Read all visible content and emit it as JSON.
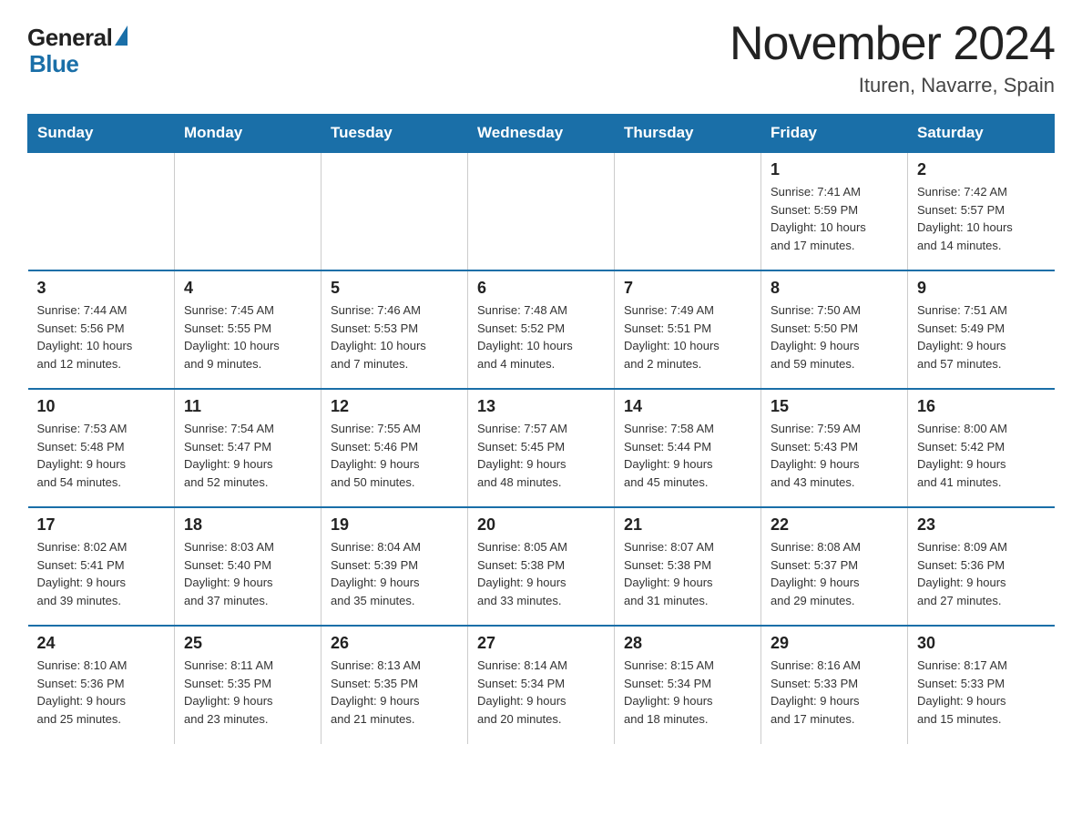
{
  "header": {
    "logo": {
      "general": "General",
      "blue": "Blue"
    },
    "title": "November 2024",
    "subtitle": "Ituren, Navarre, Spain"
  },
  "weekdays": [
    "Sunday",
    "Monday",
    "Tuesday",
    "Wednesday",
    "Thursday",
    "Friday",
    "Saturday"
  ],
  "weeks": [
    [
      {
        "day": "",
        "info": ""
      },
      {
        "day": "",
        "info": ""
      },
      {
        "day": "",
        "info": ""
      },
      {
        "day": "",
        "info": ""
      },
      {
        "day": "",
        "info": ""
      },
      {
        "day": "1",
        "info": "Sunrise: 7:41 AM\nSunset: 5:59 PM\nDaylight: 10 hours\nand 17 minutes."
      },
      {
        "day": "2",
        "info": "Sunrise: 7:42 AM\nSunset: 5:57 PM\nDaylight: 10 hours\nand 14 minutes."
      }
    ],
    [
      {
        "day": "3",
        "info": "Sunrise: 7:44 AM\nSunset: 5:56 PM\nDaylight: 10 hours\nand 12 minutes."
      },
      {
        "day": "4",
        "info": "Sunrise: 7:45 AM\nSunset: 5:55 PM\nDaylight: 10 hours\nand 9 minutes."
      },
      {
        "day": "5",
        "info": "Sunrise: 7:46 AM\nSunset: 5:53 PM\nDaylight: 10 hours\nand 7 minutes."
      },
      {
        "day": "6",
        "info": "Sunrise: 7:48 AM\nSunset: 5:52 PM\nDaylight: 10 hours\nand 4 minutes."
      },
      {
        "day": "7",
        "info": "Sunrise: 7:49 AM\nSunset: 5:51 PM\nDaylight: 10 hours\nand 2 minutes."
      },
      {
        "day": "8",
        "info": "Sunrise: 7:50 AM\nSunset: 5:50 PM\nDaylight: 9 hours\nand 59 minutes."
      },
      {
        "day": "9",
        "info": "Sunrise: 7:51 AM\nSunset: 5:49 PM\nDaylight: 9 hours\nand 57 minutes."
      }
    ],
    [
      {
        "day": "10",
        "info": "Sunrise: 7:53 AM\nSunset: 5:48 PM\nDaylight: 9 hours\nand 54 minutes."
      },
      {
        "day": "11",
        "info": "Sunrise: 7:54 AM\nSunset: 5:47 PM\nDaylight: 9 hours\nand 52 minutes."
      },
      {
        "day": "12",
        "info": "Sunrise: 7:55 AM\nSunset: 5:46 PM\nDaylight: 9 hours\nand 50 minutes."
      },
      {
        "day": "13",
        "info": "Sunrise: 7:57 AM\nSunset: 5:45 PM\nDaylight: 9 hours\nand 48 minutes."
      },
      {
        "day": "14",
        "info": "Sunrise: 7:58 AM\nSunset: 5:44 PM\nDaylight: 9 hours\nand 45 minutes."
      },
      {
        "day": "15",
        "info": "Sunrise: 7:59 AM\nSunset: 5:43 PM\nDaylight: 9 hours\nand 43 minutes."
      },
      {
        "day": "16",
        "info": "Sunrise: 8:00 AM\nSunset: 5:42 PM\nDaylight: 9 hours\nand 41 minutes."
      }
    ],
    [
      {
        "day": "17",
        "info": "Sunrise: 8:02 AM\nSunset: 5:41 PM\nDaylight: 9 hours\nand 39 minutes."
      },
      {
        "day": "18",
        "info": "Sunrise: 8:03 AM\nSunset: 5:40 PM\nDaylight: 9 hours\nand 37 minutes."
      },
      {
        "day": "19",
        "info": "Sunrise: 8:04 AM\nSunset: 5:39 PM\nDaylight: 9 hours\nand 35 minutes."
      },
      {
        "day": "20",
        "info": "Sunrise: 8:05 AM\nSunset: 5:38 PM\nDaylight: 9 hours\nand 33 minutes."
      },
      {
        "day": "21",
        "info": "Sunrise: 8:07 AM\nSunset: 5:38 PM\nDaylight: 9 hours\nand 31 minutes."
      },
      {
        "day": "22",
        "info": "Sunrise: 8:08 AM\nSunset: 5:37 PM\nDaylight: 9 hours\nand 29 minutes."
      },
      {
        "day": "23",
        "info": "Sunrise: 8:09 AM\nSunset: 5:36 PM\nDaylight: 9 hours\nand 27 minutes."
      }
    ],
    [
      {
        "day": "24",
        "info": "Sunrise: 8:10 AM\nSunset: 5:36 PM\nDaylight: 9 hours\nand 25 minutes."
      },
      {
        "day": "25",
        "info": "Sunrise: 8:11 AM\nSunset: 5:35 PM\nDaylight: 9 hours\nand 23 minutes."
      },
      {
        "day": "26",
        "info": "Sunrise: 8:13 AM\nSunset: 5:35 PM\nDaylight: 9 hours\nand 21 minutes."
      },
      {
        "day": "27",
        "info": "Sunrise: 8:14 AM\nSunset: 5:34 PM\nDaylight: 9 hours\nand 20 minutes."
      },
      {
        "day": "28",
        "info": "Sunrise: 8:15 AM\nSunset: 5:34 PM\nDaylight: 9 hours\nand 18 minutes."
      },
      {
        "day": "29",
        "info": "Sunrise: 8:16 AM\nSunset: 5:33 PM\nDaylight: 9 hours\nand 17 minutes."
      },
      {
        "day": "30",
        "info": "Sunrise: 8:17 AM\nSunset: 5:33 PM\nDaylight: 9 hours\nand 15 minutes."
      }
    ]
  ]
}
